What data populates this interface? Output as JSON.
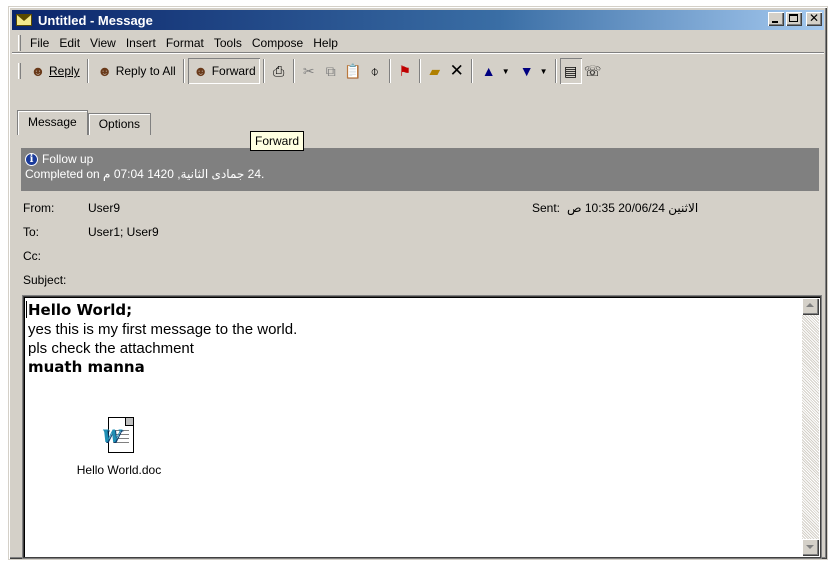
{
  "window": {
    "title": "Untitled - Message",
    "title_gradient_start": "#0a246a",
    "title_gradient_end": "#a6caf0",
    "icon": "envelope-icon"
  },
  "menu": {
    "items": [
      "File",
      "Edit",
      "View",
      "Insert",
      "Format",
      "Tools",
      "Compose",
      "Help"
    ]
  },
  "toolbar": {
    "reply_label": "Reply",
    "reply_all_label": "Reply to All",
    "forward_label": "Forward",
    "icons": [
      "reply-icon",
      "reply-all-icon",
      "forward-icon",
      "print-icon",
      "cut-icon",
      "copy-icon",
      "paste-icon",
      "attach-icon",
      "flag-icon",
      "move-to-folder-icon",
      "delete-icon",
      "previous-item-icon",
      "next-item-icon",
      "properties-icon",
      "address-book-icon"
    ]
  },
  "tooltip": {
    "text": "Forward"
  },
  "tabs": [
    {
      "label": "Message",
      "active": true
    },
    {
      "label": "Options",
      "active": false
    }
  ],
  "info_bar": {
    "line1": "Follow up",
    "line2_prefix": "Completed on ",
    "line2_date": ".24 جمادى الثانية, 1420 07:04 م"
  },
  "header": {
    "from_label": "From:",
    "from_value": "User9",
    "to_label": "To:",
    "to_value": "User1; User9",
    "cc_label": "Cc:",
    "cc_value": "",
    "subject_label": "Subject:",
    "subject_value": "",
    "sent_label": "Sent:",
    "sent_value": "الاثنين 20/06/24 10:35 ص"
  },
  "body": {
    "line1": "Hello World;",
    "line2": "yes this is my first message to the world.",
    "line3": "pls check the attachment",
    "line4": "muath manna"
  },
  "attachment": {
    "filename": "Hello World.doc",
    "icon": "word-document-icon"
  }
}
